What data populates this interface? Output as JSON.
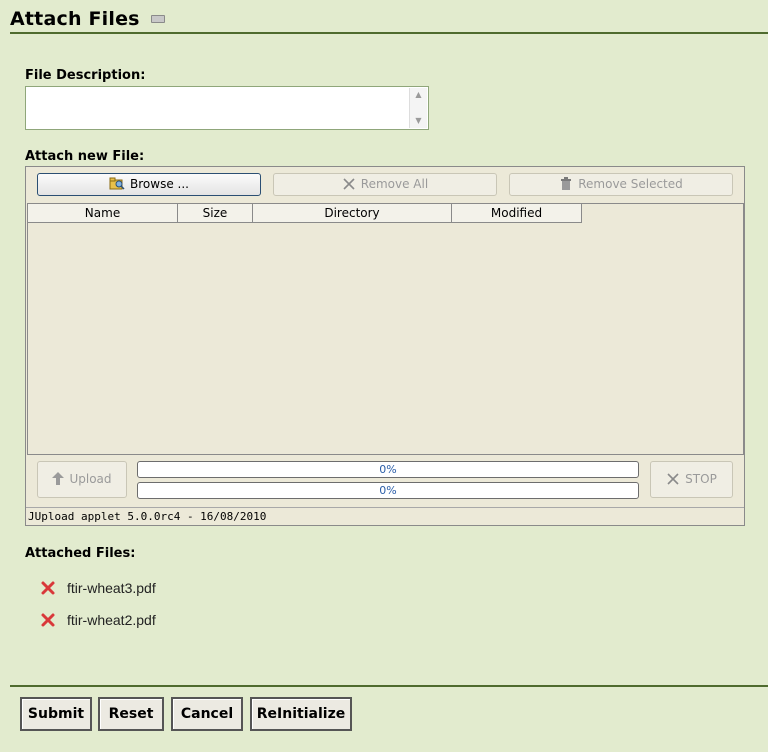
{
  "page": {
    "title": "Attach Files"
  },
  "description": {
    "label": "File Description:",
    "value": ""
  },
  "applet": {
    "label": "Attach new File:",
    "browse_label": "Browse ...",
    "remove_all_label": "Remove All",
    "remove_selected_label": "Remove Selected",
    "columns": [
      "Name",
      "Size",
      "Directory",
      "Modified"
    ],
    "upload_label": "Upload",
    "stop_label": "STOP",
    "progress": [
      {
        "text": "0%",
        "value": 0
      },
      {
        "text": "0%",
        "value": 0
      }
    ],
    "version": "JUpload applet 5.0.0rc4 - 16/08/2010"
  },
  "attached": {
    "label": "Attached Files:",
    "files": [
      {
        "name": "ftir-wheat3.pdf",
        "icon": "delete-x-icon"
      },
      {
        "name": "ftir-wheat2.pdf",
        "icon": "delete-x-icon"
      }
    ]
  },
  "actions": {
    "submit": "Submit",
    "reset": "Reset",
    "cancel": "Cancel",
    "reinitialize": "ReInitialize"
  },
  "colors": {
    "background": "#e2ebce",
    "rule": "#4f6b2e",
    "applet_bg": "#ece9d8",
    "delete_icon": "#d9383a",
    "progress_text": "#2b5ea8"
  }
}
